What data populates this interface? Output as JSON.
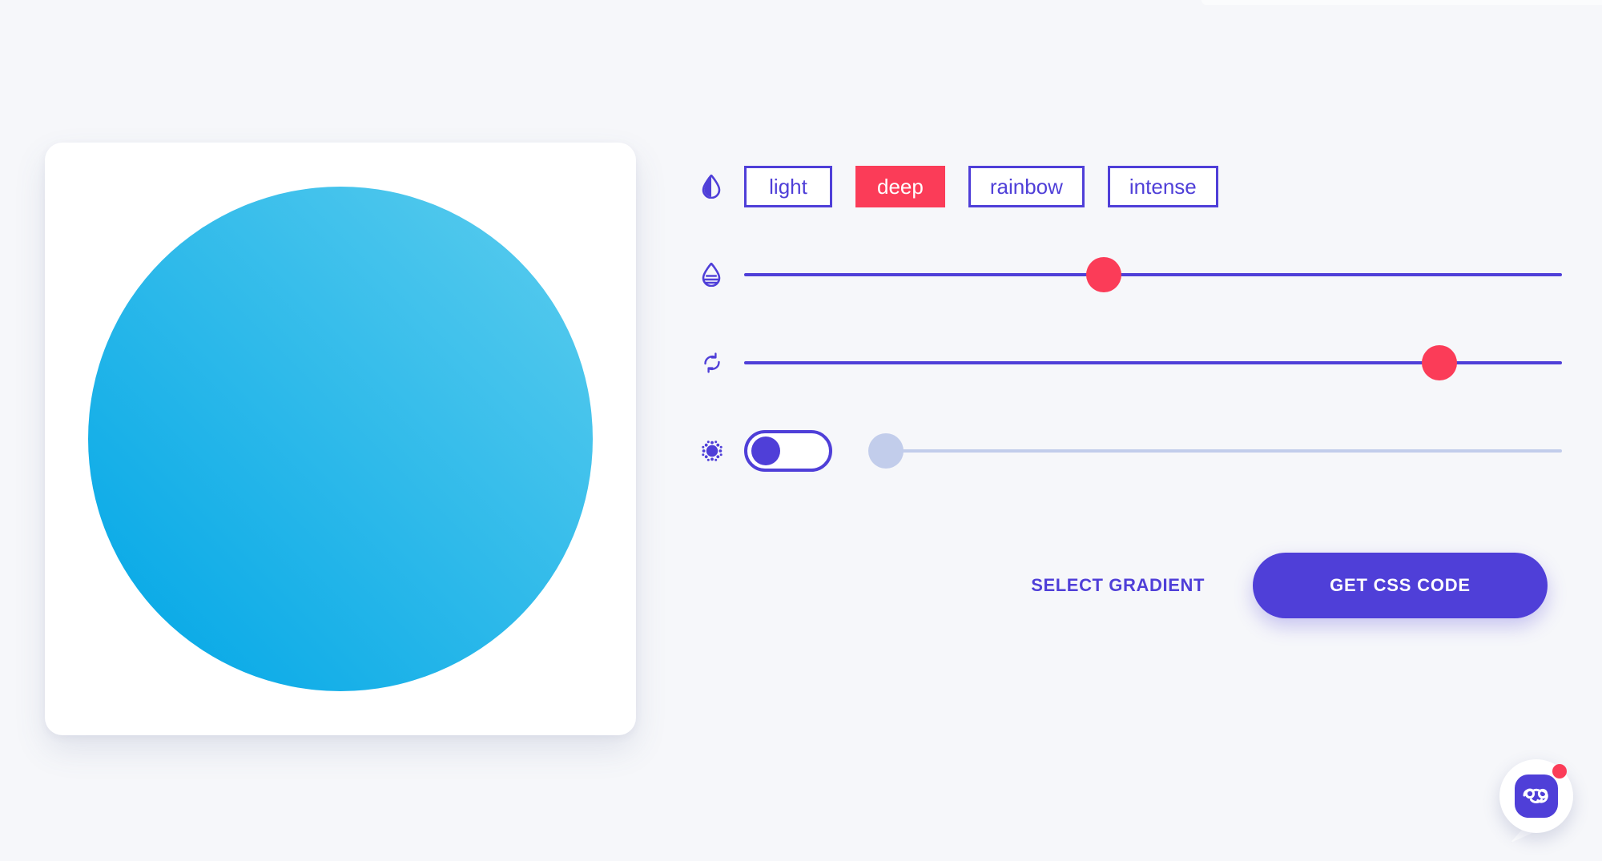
{
  "theme": {
    "page_background": "#f6f7fa",
    "accent_purple": "#4f3fd8",
    "accent_red": "#fb3c58",
    "card_background": "#ffffff",
    "disabled_blue": "#c2cdeb"
  },
  "preview": {
    "shape": "circle",
    "gradient_from": "#5ccdee",
    "gradient_to": "#00a6e6",
    "gradient_css": "linear-gradient(225deg, #5ccdee 0%, #00a6e6 100%)"
  },
  "controls": {
    "style_row": {
      "icon": "droplet-half-icon",
      "tabs": [
        {
          "label": "light",
          "active": false
        },
        {
          "label": "deep",
          "active": true
        },
        {
          "label": "rainbow",
          "active": false
        },
        {
          "label": "intense",
          "active": false
        }
      ]
    },
    "shade_row": {
      "icon": "droplet-layers-icon",
      "slider": {
        "name": "shade-slider",
        "value_percent": 44,
        "disabled": false
      }
    },
    "rotation_row": {
      "icon": "refresh-rotate-icon",
      "slider": {
        "name": "rotation-slider",
        "value_percent": 85,
        "disabled": false
      }
    },
    "noise_row": {
      "icon": "grain-noise-icon",
      "toggle": {
        "name": "noise-toggle",
        "on": false
      },
      "slider": {
        "name": "noise-slider",
        "value_percent": 2,
        "disabled": true
      }
    }
  },
  "actions": {
    "select_gradient_label": "SELECT GRADIENT",
    "get_css_code_label": "GET CSS CODE"
  },
  "chat_widget": {
    "icon": "chat-smiley-avatar-icon",
    "has_notification": true
  }
}
